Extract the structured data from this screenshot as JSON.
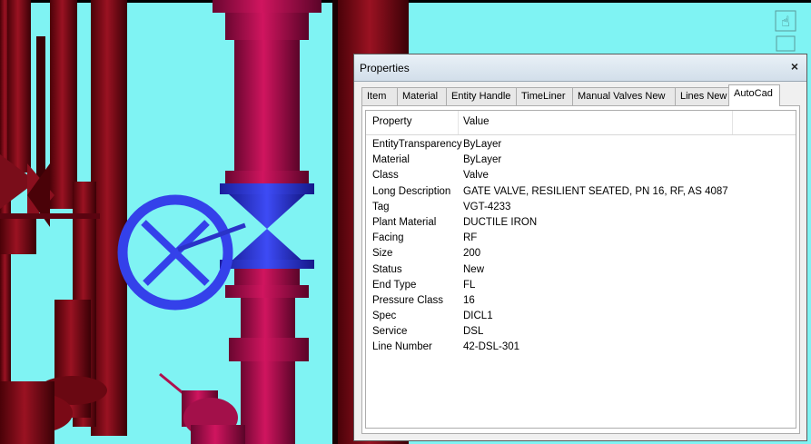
{
  "dialog": {
    "title": "Properties",
    "close_glyph": "×",
    "tabs": [
      {
        "label": "Item"
      },
      {
        "label": "Material"
      },
      {
        "label": "Entity Handle"
      },
      {
        "label": "TimeLiner"
      },
      {
        "label": "Manual Valves New"
      },
      {
        "label": "Lines New"
      },
      {
        "label": "AutoCad"
      }
    ],
    "active_tab": "AutoCad",
    "grid": {
      "header_property": "Property",
      "header_value": "Value",
      "rows": [
        {
          "property": "EntityTransparency",
          "value": "ByLayer"
        },
        {
          "property": "Material",
          "value": "ByLayer"
        },
        {
          "property": "Class",
          "value": "Valve"
        },
        {
          "property": "Long Description",
          "value": "GATE VALVE, RESILIENT SEATED, PN 16, RF, AS 4087"
        },
        {
          "property": "Tag",
          "value": "VGT-4233"
        },
        {
          "property": "Plant Material",
          "value": "DUCTILE IRON"
        },
        {
          "property": "Facing",
          "value": "RF"
        },
        {
          "property": "Size",
          "value": "200"
        },
        {
          "property": "Status",
          "value": "New"
        },
        {
          "property": "End Type",
          "value": "FL"
        },
        {
          "property": "Pressure Class",
          "value": "16"
        },
        {
          "property": "Spec",
          "value": "DICL1"
        },
        {
          "property": "Service",
          "value": "DSL"
        },
        {
          "property": "Line Number",
          "value": "42-DSL-301"
        }
      ]
    }
  },
  "scene": {
    "background_color": "#7ff3f3",
    "pipe_color": "#8c0f1c",
    "pipe_magenta_color": "#c8145c",
    "valve_blue_color": "#2a36e0",
    "pan_tool_icon": "hand-icon"
  }
}
